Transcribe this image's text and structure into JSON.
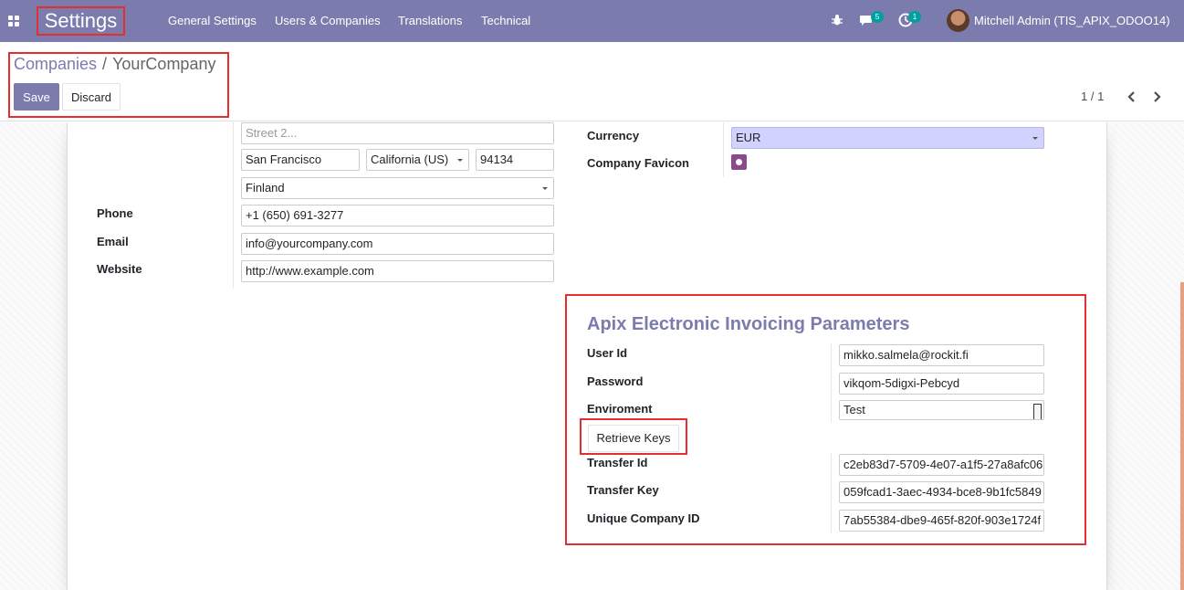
{
  "navbar": {
    "app_title": "Settings",
    "menu": [
      "General Settings",
      "Users & Companies",
      "Translations",
      "Technical"
    ],
    "messages_badge": "5",
    "activities_badge": "1",
    "user_name": "Mitchell Admin (TIS_APIX_ODOO14)",
    "color": "#7c7bad"
  },
  "breadcrumb": {
    "parent": "Companies",
    "separator": "/",
    "current": "YourCompany"
  },
  "buttons": {
    "save": "Save",
    "discard": "Discard",
    "retrieve_keys": "Retrieve Keys"
  },
  "pager": {
    "value": "1 / 1"
  },
  "address": {
    "street2_placeholder": "Street 2...",
    "city": "San Francisco",
    "state": "California (US)",
    "zip": "94134",
    "country": "Finland"
  },
  "contact": {
    "phone_label": "Phone",
    "phone": "+1 (650) 691-3277",
    "email_label": "Email",
    "email": "info@yourcompany.com",
    "website_label": "Website",
    "website": "http://www.example.com"
  },
  "right": {
    "currency_label": "Currency",
    "currency": "EUR",
    "favicon_label": "Company Favicon"
  },
  "apix": {
    "title": "Apix Electronic Invoicing Parameters",
    "user_id_label": "User Id",
    "user_id": "mikko.salmela@rockit.fi",
    "password_label": "Password",
    "password": "vikqom-5digxi-Pebcyd",
    "environment_label": "Enviroment",
    "environment": "Test",
    "transfer_id_label": "Transfer Id",
    "transfer_id": "c2eb83d7-5709-4e07-a1f5-27a8afc06",
    "transfer_key_label": "Transfer Key",
    "transfer_key": "059fcad1-3aec-4934-bce8-9b1fc5849",
    "company_id_label": "Unique Company ID",
    "company_id": "7ab55384-dbe9-465f-820f-903e1724f"
  },
  "colors": {
    "highlight": "#e52f2f",
    "accent": "#7c7bad",
    "badge": "#00a09d"
  }
}
